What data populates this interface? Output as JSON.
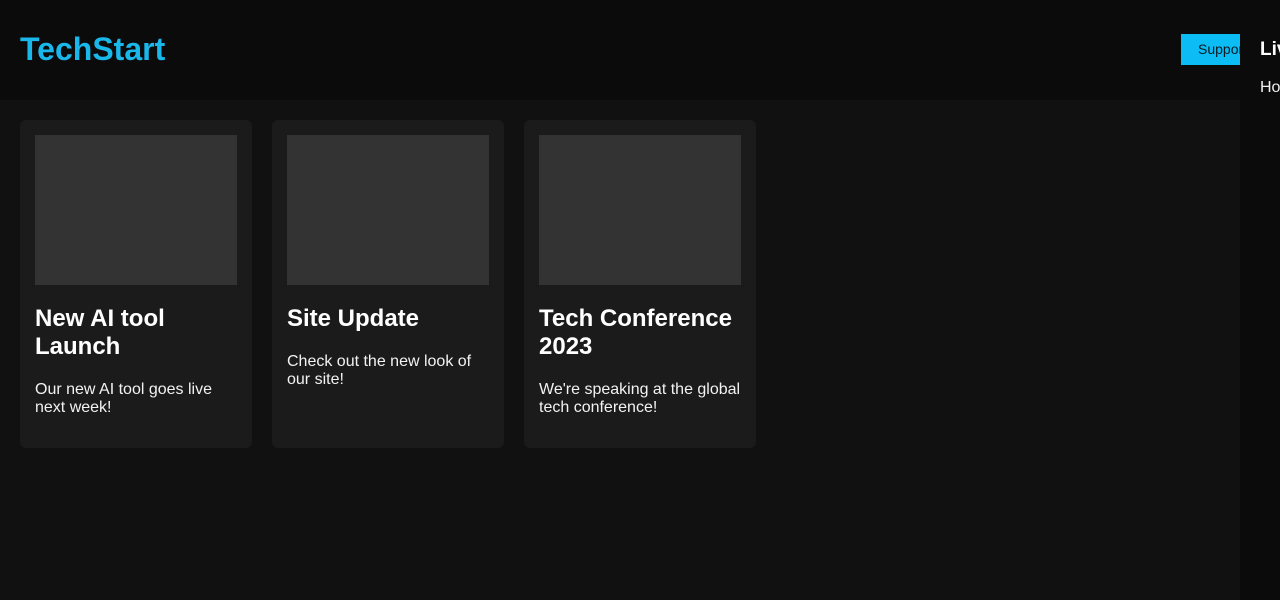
{
  "header": {
    "logo": "TechStart",
    "support_label": "Support"
  },
  "cards": [
    {
      "title": "New AI tool Launch",
      "text": "Our new AI tool goes live next week!"
    },
    {
      "title": "Site Update",
      "text": "Check out the new look of our site!"
    },
    {
      "title": "Tech Conference 2023",
      "text": "We're speaking at the global tech conference!"
    }
  ],
  "sidebar": {
    "title": "Live",
    "item": "Ho"
  },
  "colors": {
    "accent": "#1ab7ea",
    "button": "#0bbcf5",
    "background": "#111111",
    "card": "#1b1b1b",
    "image_placeholder": "#333333"
  }
}
